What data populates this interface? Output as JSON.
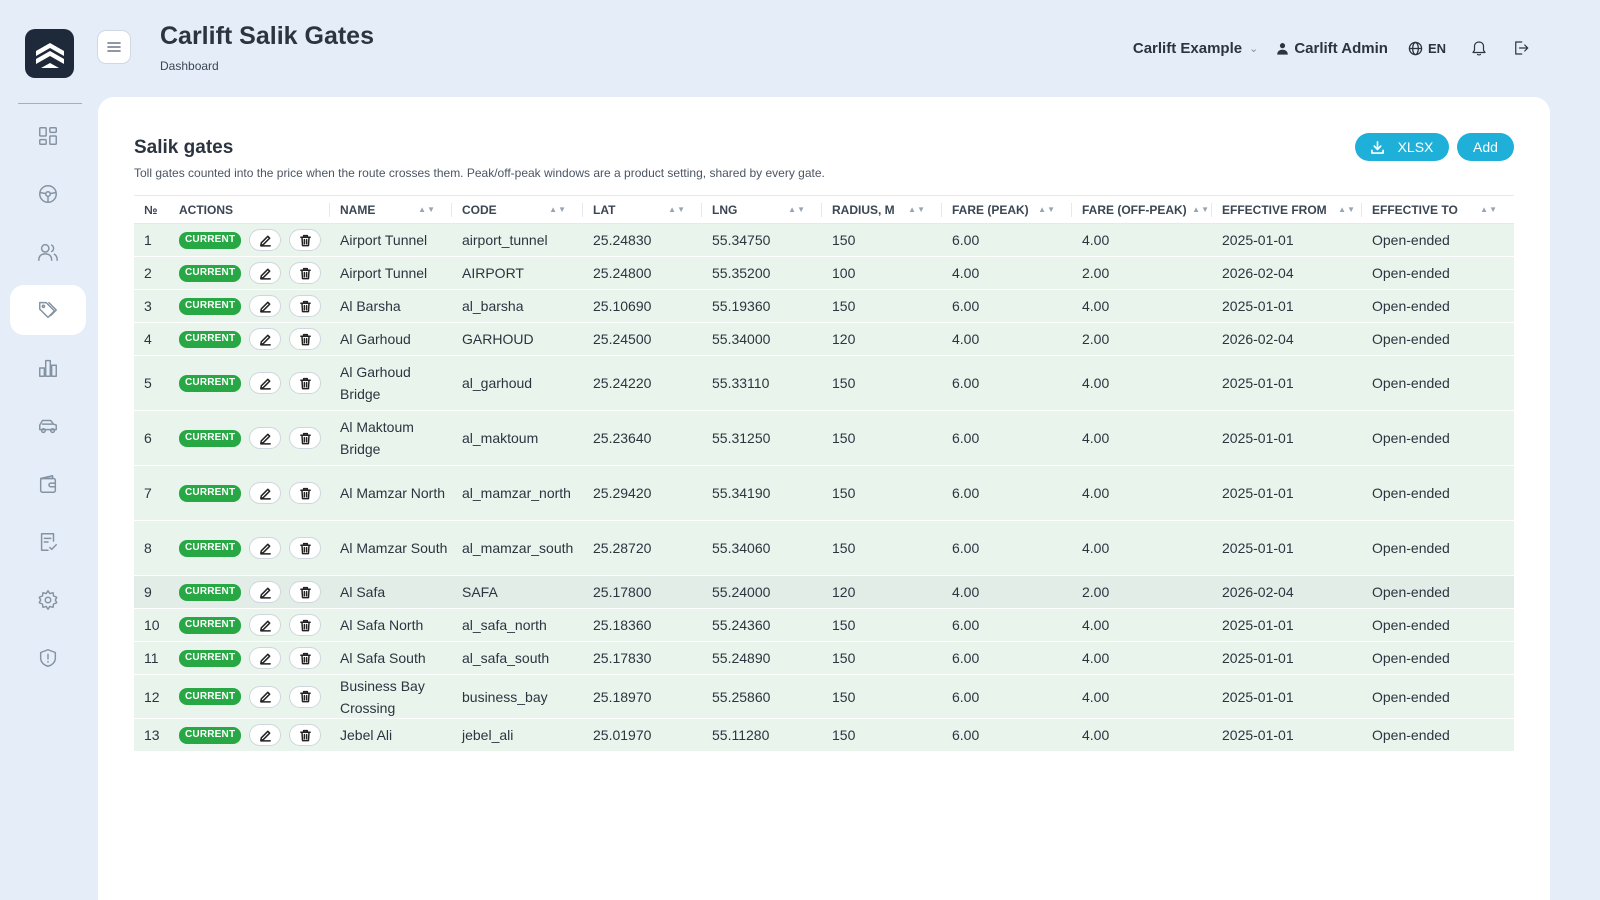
{
  "header": {
    "title": "Carlift Salik Gates",
    "breadcrumb": "Dashboard",
    "org_selector": "Carlift Example",
    "user": "Carlift Admin",
    "language": "EN"
  },
  "sidebar": {
    "items": [
      {
        "icon": "dashboard-icon",
        "active": false
      },
      {
        "icon": "steering-wheel-icon",
        "active": false
      },
      {
        "icon": "users-icon",
        "active": false
      },
      {
        "icon": "tags-icon",
        "active": true
      },
      {
        "icon": "bar-chart-icon",
        "active": false
      },
      {
        "icon": "car-icon",
        "active": false
      },
      {
        "icon": "wallet-icon",
        "active": false
      },
      {
        "icon": "checklist-icon",
        "active": false
      },
      {
        "icon": "settings-icon",
        "active": false
      },
      {
        "icon": "shield-icon",
        "active": false
      }
    ]
  },
  "card": {
    "title": "Salik gates",
    "subtitle": "Toll gates counted into the price when the route crosses them. Peak/off-peak windows are a product setting, shared by every gate.",
    "xlsx_label": "XLSX",
    "add_label": "Add"
  },
  "table": {
    "columns": [
      "№",
      "ACTIONS",
      "NAME",
      "CODE",
      "LAT",
      "LNG",
      "RADIUS, M",
      "FARE (PEAK)",
      "FARE (OFF-PEAK)",
      "EFFECTIVE FROM",
      "EFFECTIVE TO"
    ],
    "badge_label": "CURRENT",
    "rows": [
      {
        "n": "1",
        "name": "Airport Tunnel",
        "code": "airport_tunnel",
        "lat": "25.24830",
        "lng": "55.34750",
        "radius": "150",
        "peak": "6.00",
        "offpeak": "4.00",
        "from": "2025-01-01",
        "to": "Open-ended"
      },
      {
        "n": "2",
        "name": "Airport Tunnel",
        "code": "AIRPORT",
        "lat": "25.24800",
        "lng": "55.35200",
        "radius": "100",
        "peak": "4.00",
        "offpeak": "2.00",
        "from": "2026-02-04",
        "to": "Open-ended"
      },
      {
        "n": "3",
        "name": "Al Barsha",
        "code": "al_barsha",
        "lat": "25.10690",
        "lng": "55.19360",
        "radius": "150",
        "peak": "6.00",
        "offpeak": "4.00",
        "from": "2025-01-01",
        "to": "Open-ended"
      },
      {
        "n": "4",
        "name": "Al Garhoud",
        "code": "GARHOUD",
        "lat": "25.24500",
        "lng": "55.34000",
        "radius": "120",
        "peak": "4.00",
        "offpeak": "2.00",
        "from": "2026-02-04",
        "to": "Open-ended"
      },
      {
        "n": "5",
        "name": "Al Garhoud Bridge",
        "code": "al_garhoud",
        "lat": "25.24220",
        "lng": "55.33110",
        "radius": "150",
        "peak": "6.00",
        "offpeak": "4.00",
        "from": "2025-01-01",
        "to": "Open-ended"
      },
      {
        "n": "6",
        "name": "Al Maktoum Bridge",
        "code": "al_maktoum",
        "lat": "25.23640",
        "lng": "55.31250",
        "radius": "150",
        "peak": "6.00",
        "offpeak": "4.00",
        "from": "2025-01-01",
        "to": "Open-ended"
      },
      {
        "n": "7",
        "name": "Al Mamzar North",
        "code": "al_mamzar_north",
        "lat": "25.29420",
        "lng": "55.34190",
        "radius": "150",
        "peak": "6.00",
        "offpeak": "4.00",
        "from": "2025-01-01",
        "to": "Open-ended"
      },
      {
        "n": "8",
        "name": "Al Mamzar South",
        "code": "al_mamzar_south",
        "lat": "25.28720",
        "lng": "55.34060",
        "radius": "150",
        "peak": "6.00",
        "offpeak": "4.00",
        "from": "2025-01-01",
        "to": "Open-ended"
      },
      {
        "n": "9",
        "name": "Al Safa",
        "code": "SAFA",
        "lat": "25.17800",
        "lng": "55.24000",
        "radius": "120",
        "peak": "4.00",
        "offpeak": "2.00",
        "from": "2026-02-04",
        "to": "Open-ended"
      },
      {
        "n": "10",
        "name": "Al Safa North",
        "code": "al_safa_north",
        "lat": "25.18360",
        "lng": "55.24360",
        "radius": "150",
        "peak": "6.00",
        "offpeak": "4.00",
        "from": "2025-01-01",
        "to": "Open-ended"
      },
      {
        "n": "11",
        "name": "Al Safa South",
        "code": "al_safa_south",
        "lat": "25.17830",
        "lng": "55.24890",
        "radius": "150",
        "peak": "6.00",
        "offpeak": "4.00",
        "from": "2025-01-01",
        "to": "Open-ended"
      },
      {
        "n": "12",
        "name": "Business Bay Crossing",
        "code": "business_bay",
        "lat": "25.18970",
        "lng": "55.25860",
        "radius": "150",
        "peak": "6.00",
        "offpeak": "4.00",
        "from": "2025-01-01",
        "to": "Open-ended"
      },
      {
        "n": "13",
        "name": "Jebel Ali",
        "code": "jebel_ali",
        "lat": "25.01970",
        "lng": "55.11280",
        "radius": "150",
        "peak": "6.00",
        "offpeak": "4.00",
        "from": "2025-01-01",
        "to": "Open-ended"
      }
    ]
  },
  "colors": {
    "accent": "#1fb0d9",
    "current_badge": "#27a844",
    "row_bg": "#e9f5ec",
    "logo_bg": "#1e2a3a"
  }
}
